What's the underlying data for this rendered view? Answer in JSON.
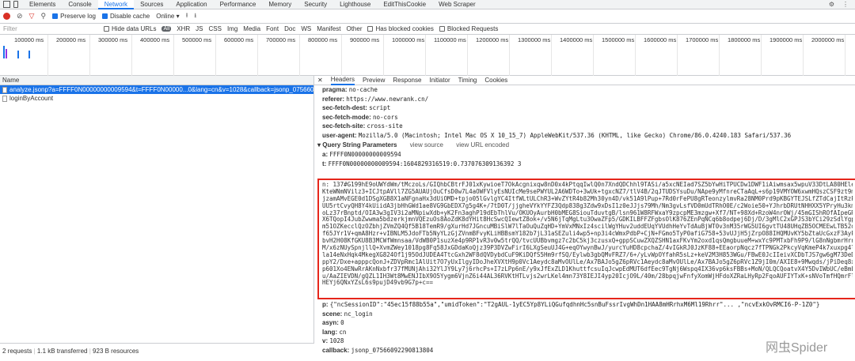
{
  "tabs": [
    "Elements",
    "Console",
    "Network",
    "Sources",
    "Application",
    "Performance",
    "Memory",
    "Security",
    "Lighthouse",
    "EditThisCookie",
    "Web Scraper"
  ],
  "toolbar": {
    "preserve_log": "Preserve log",
    "disable_cache": "Disable cache",
    "throttle": "Online"
  },
  "filter": {
    "placeholder": "Filter",
    "hide_data": "Hide data URLs",
    "all": "All",
    "types": [
      "XHR",
      "JS",
      "CSS",
      "Img",
      "Media",
      "Font",
      "Doc",
      "WS",
      "Manifest",
      "Other"
    ],
    "blocked_cookies": "Has blocked cookies",
    "blocked_req": "Blocked Requests"
  },
  "timeline_ticks": [
    "100000 ms",
    "200000 ms",
    "300000 ms",
    "400000 ms",
    "500000 ms",
    "600000 ms",
    "700000 ms",
    "800000 ms",
    "900000 ms",
    "1000000 ms",
    "1100000 ms",
    "1200000 ms",
    "1300000 ms",
    "1400000 ms",
    "1500000 ms",
    "1600000 ms",
    "1700000 ms",
    "1800000 ms",
    "1900000 ms",
    "2000000 ms"
  ],
  "list": {
    "header": "Name",
    "rows": [
      "analyze.jsonp?a=FFFF0N00000000009594&t=FFFF0N00000...0&lang=cn&v=1028&callback=jsonp_07566092290813804",
      "loginByAccount"
    ]
  },
  "status": {
    "requests": "2 requests",
    "transferred": "1.1 kB transferred",
    "resources": "923 B resources"
  },
  "detail_tabs": [
    "Headers",
    "Preview",
    "Response",
    "Initiator",
    "Timing",
    "Cookies"
  ],
  "headers": [
    {
      "k": "pragma:",
      "v": "no-cache"
    },
    {
      "k": "referer:",
      "v": "https://www.newrank.cn/"
    },
    {
      "k": "sec-fetch-dest:",
      "v": "script"
    },
    {
      "k": "sec-fetch-mode:",
      "v": "no-cors"
    },
    {
      "k": "sec-fetch-site:",
      "v": "cross-site"
    },
    {
      "k": "user-agent:",
      "v": "Mozilla/5.0 (Macintosh; Intel Mac OS X 10_15_7) AppleWebKit/537.36 (KHTML, like Gecko) Chrome/86.0.4240.183 Safari/537.36"
    }
  ],
  "qs": {
    "title": "▾ Query String Parameters",
    "view_source": "view source",
    "view_url": "view URL encoded"
  },
  "params_top": [
    {
      "k": "a:",
      "v": "FFFF0N00000000009594"
    },
    {
      "k": "t:",
      "v": "FFFF0N00000000009594:1604829316519:0.737076309136392 3"
    }
  ],
  "n_lines": [
    "n: 137#G199hE9oUWYdWm/tMczoLs/GIQhbCBtrFJ01xKywioeT7OkAcgnixqw8nD0x4kPtqqIwlQ0n7XndQDChhl9TASi/a5xcNEIad7SZ5bYwHiTPUCDw1DWF1iAiwmsax5wpuV33DtLA80HEleLCz72ZxWtEvCAe9e",
    "KteWNmNVilz3+ICJtpAVll7ZG5AUAUjOuCfsD0w7L4aOWFVlyEsNUIcMe9sePWYUL2A6WDTo+3wUk+tgxcNZ7/tlV4B/2qJTUDSYsuDu/NApe9yMfnreCTaAqL+s6p19VMYOW6xwmHQszCSF9zt9mH8aKTb4jHCwGkcAR",
    "jzamAMvEGE0d1DSgXGB8X1aNFgnaHx3dUiOMD+tpjo05lGvlgYC4ItfWLtULChR3+WvZYtR4b82Mh30yn4D/vk51A9lPup+7Rd0rFePU8gRTeonzylmvRa28NM0Prd9pKBGYTEJSLfZTdCajItRzPzsZOP+6tn8Rxcol",
    "UU5rtCvyQH8Y4kUiidA3jbHhGWd1ae8VG9GbEDX7g5g4K+/7tD0T/jjgheVYkYYFZ3Qdp838g3Zdw9xDsI1z0eJJjs79Mh/Nm3gvLsfVD0mUdTRhO0E/c2Woie50+YJhrbDRUtNHHXX5YPryHu3km74+OMmNji5flu/g",
    "oLz37rBnptd/OIA3w3gIV3i2aMNpiwXdb+yK2Fn3aghP19dEbThlVu/OKUOyAurbH0bMEG8SiouTduvtgB/lsn961W8RFWxaY9zpcpME3mzgw+Xf7/NT+98Xd+RzoW4nrOWj/45mGIShROfAIpeGRdrFVLzll9YHau6QHA",
    "X6TQopI4JubZwwma5bdzerkjmnVQEzuOs8AoZdK8dYHit8HcSwcQIewtZ8ok+/v5N6jTqMgLtu3OwaZFp5/GDKILBFFZFgbsOlK876ZEnPqNCq6b8odpej6Dj/D/3gMlC2xGPJS3bYCi29zSdlYgp1GcX9aQUGKWtS+v",
    "m51OZKecclQzOZbhjZVmZQ4Qf5B18TemR9/gXurHd7JGncuMBiSlW7lTaOuQuZqHD+YmVxMNxIz4scilWgYHuv2uddEUqYVUdhHeYvTdAuBjWT0v3nM35rWG5UI6gvtTU48UHqZB5OCMEEwLTB52osNKlEpKBKHBrdG2",
    "f65JYr1V+qmA8Hzr+vIBNLM5JdoFTb5NyYLzGjZVnmBFvyKLiHBBsmY182b7jL31aSEZuli4wp5+np3i4cWmxPdbP+CjN+FGmo5TyP0afiG758+53vUJjH5jZrpO88IHQMUvKY5bZtaUcGxzF3AyPqOHM5tUWzgllucDZ",
    "bvH2H08KfGKU8B3MCWfWmnsaa/VdWB0P1suzXe4p9RP1vR3v0w5trQQ/tvcUUBbvmgz7c2bC5kj3czusxQ+gppSCuwZXQZSHN1axFKvYm2oxd1qsQmgbuueM+wxYc9PMTxbFh9P9/lG8nNgbmrHrn+OdwlypFYdOf+0",
    "M/x6zNUySpnjllQ+XvmZWey1018pg8Fq58JxGDdaKoQjz39P3DVZwFirI6LXgSeuUJ4G+eqOYwynBwJ/yurcYuHD8cpchaZ/4vIGkRJ0JzKF88+EEaorpNqcz7fTPNGk2PkcyVqKmeP4k7xuxpg4laxZdPhU1SJFqvMlT",
    "la14eNxHqk4MkegXG824Of1j95OdJUDEA4TtcGxh2WF8dQVDybdCuF9KiDQfS5Hm9rfSQ/Eylwb3gbQMvFRZ7/6+/yLvWpOYfahR5sLz+keV2M3H853WGu/FBwE0JcIIeivXCDbTJS7gw6gM73DeDgOhXpgRam1KIVdd",
    "ppY2/Dxe+apppcQonJ+ZDVpRmc1AlUit7O7yUxIlgyIDoJheXVXtH9p0Vc1Aeydc8aMvOUlLe/Ax7BAJo5gZ6pRVc1Aeydc8aMvOUlLe/Ax7BAJo5gZ6pRVc1Z9jI0m/AXIE8+9Mwqds/jPiDeq8xFDS9SUSJ0+CtuPzbjt",
    "p601Xo4ENwRrAKnNxbfr37fMUNjAhi32YlJY9Ly7j6rhcPs+I7zLPp6nE/y9xJfExZLD1KhuttfcsuIqJcwpEdMUT6dfEec9TgNj6Wspq4IX36vp6ksFBBs+MoN/QLQCQoatvX4Y5DvIWbUC/eBmLZiM/SzCCwKhcl",
    "u/AaZIEVDN/gQZL1IH3Wt8MwENJIbX9O5Yygm6VjnZ6i44AL36RVKtHTLvjs2wrLKel4mn73Y8IEJI4yp20IcjO9L/40m/28bpqjwFnfyXomWjHFdoXZRaLHyRp2FqoAUFIYTxK+sNVoTmfHQmrFlz9AoP4VqML6/eps",
    "HEYj6QNxYZsL6s9pujD49vb9G7p+c=="
  ],
  "params_bottom": [
    {
      "k": "p:",
      "v": "{\"ncSessionID\":\"45ec15f88b55a\",\"umidToken\":\"T2gAUL-1yEC5Yp8YLiQGufqdhnHc5snBuFssrIvgWhDn1HAA8mHRrhxM6Ml19Rhrr\"... ,\"ncvExkOvRMCI6-P-1Z0\"}"
    },
    {
      "k": "scene:",
      "v": "nc_login"
    },
    {
      "k": "asyn:",
      "v": "0"
    },
    {
      "k": "lang:",
      "v": "cn"
    },
    {
      "k": "v:",
      "v": "1028"
    },
    {
      "k": "callback:",
      "v": "jsonp_07566092290813804"
    }
  ],
  "watermark": "网虫Spider",
  "colors": {
    "accent": "#1a73e8",
    "highlight_box": "#e5261b",
    "record": "#d93025"
  }
}
